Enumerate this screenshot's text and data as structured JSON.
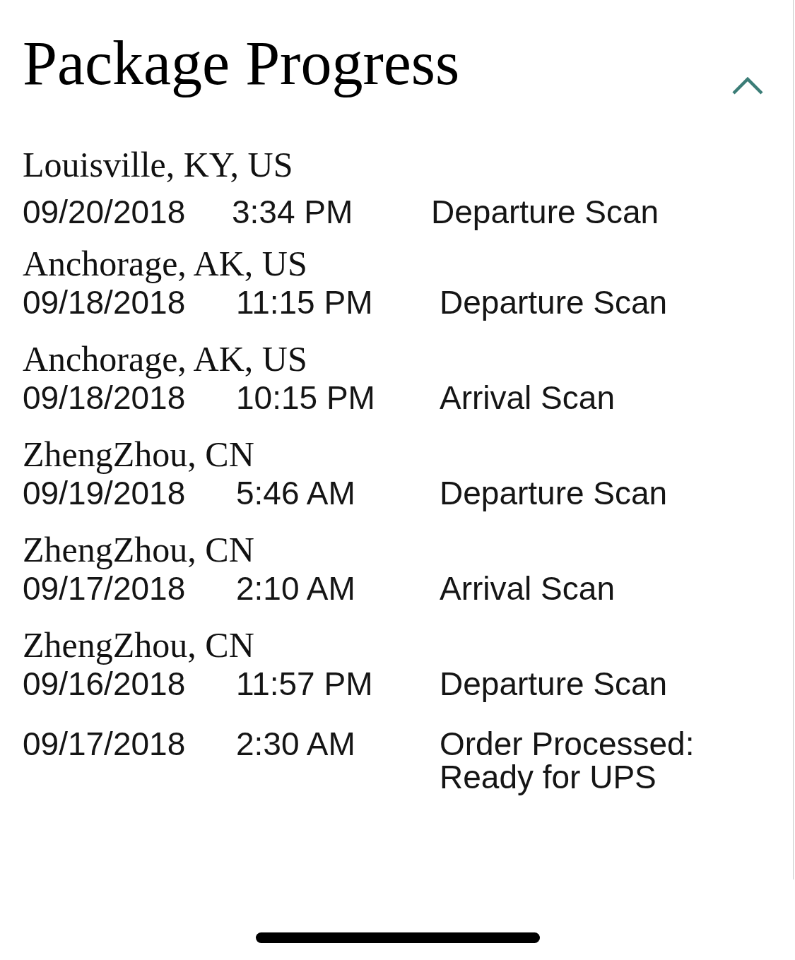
{
  "section": {
    "title": "Package Progress",
    "expanded": true,
    "events": [
      {
        "location": "Louisville, KY, US",
        "date": "09/20/2018",
        "time": "3:34 PM",
        "status": "Departure Scan"
      },
      {
        "location": "Anchorage, AK, US",
        "date": "09/18/2018",
        "time": "11:15 PM",
        "status": "Departure Scan"
      },
      {
        "location": "Anchorage, AK, US",
        "date": "09/18/2018",
        "time": "10:15 PM",
        "status": "Arrival Scan"
      },
      {
        "location": "ZhengZhou, CN",
        "date": "09/19/2018",
        "time": "5:46 AM",
        "status": "Departure Scan"
      },
      {
        "location": "ZhengZhou, CN",
        "date": "09/17/2018",
        "time": "2:10 AM",
        "status": "Arrival Scan"
      },
      {
        "location": "ZhengZhou, CN",
        "date": "09/16/2018",
        "time": "11:57 PM",
        "status": "Departure Scan"
      },
      {
        "date": "09/17/2018",
        "time": "2:30 AM",
        "status": "Order Processed: Ready for UPS"
      }
    ]
  }
}
